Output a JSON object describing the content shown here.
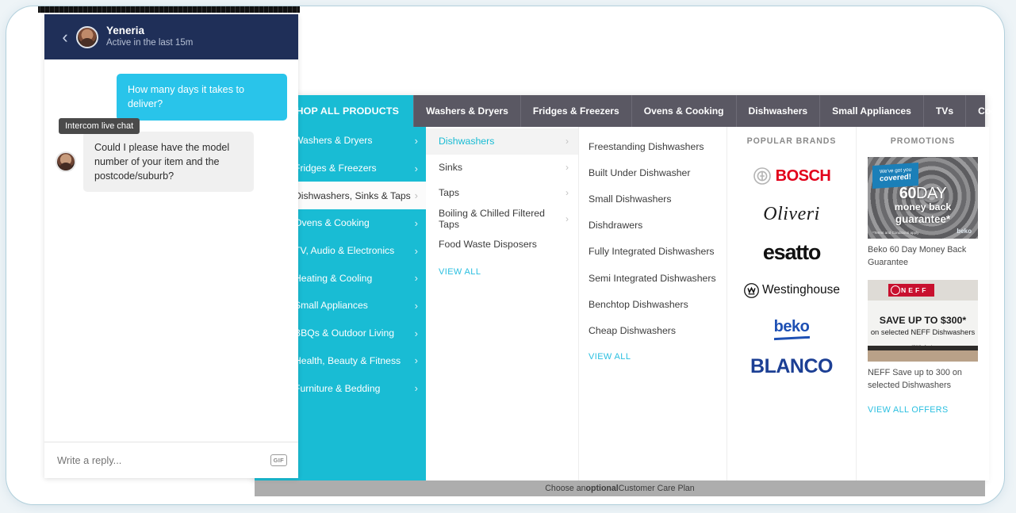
{
  "chat": {
    "back_icon": "chevron-left-icon",
    "name": "Yeneria",
    "status": "Active in the last 15m",
    "tooltip": "Intercom live chat",
    "messages": [
      {
        "from": "user",
        "text": "How many days it takes to deliver?"
      },
      {
        "from": "agent",
        "text": "Could I please have the model number of your item and the postcode/suburb?"
      }
    ],
    "reply_placeholder": "Write a reply...",
    "gif_label": "GIF"
  },
  "shop": {
    "shop_all_label": "SHOP ALL PRODUCTS",
    "menu_icon": "hamburger-icon",
    "nav_items": [
      "Washers & Dryers",
      "Fridges & Freezers",
      "Ovens & Cooking",
      "Dishwashers",
      "Small Appliances",
      "TVs",
      "Cooling"
    ],
    "categories": [
      {
        "label": "Washers & Dryers",
        "icon": "washer-icon",
        "active": false
      },
      {
        "label": "Fridges & Freezers",
        "icon": "fridge-icon",
        "active": false
      },
      {
        "label": "Dishwashers, Sinks & Taps",
        "icon": "dishwasher-icon",
        "active": true
      },
      {
        "label": "Ovens & Cooking",
        "icon": "cooktop-icon",
        "active": false
      },
      {
        "label": "TV, Audio & Electronics",
        "icon": "tv-icon",
        "active": false
      },
      {
        "label": "Heating & Cooling",
        "icon": "aircon-icon",
        "active": false
      },
      {
        "label": "Small Appliances",
        "icon": "blender-icon",
        "active": false
      },
      {
        "label": "BBQs & Outdoor Living",
        "icon": "bbq-icon",
        "active": false
      },
      {
        "label": "Health, Beauty & Fitness",
        "icon": "scales-icon",
        "active": false
      },
      {
        "label": "Furniture & Bedding",
        "icon": "sofa-icon",
        "active": false
      }
    ],
    "subcategories": [
      {
        "label": "Dishwashers",
        "active": true,
        "arrow": true
      },
      {
        "label": "Sinks",
        "active": false,
        "arrow": true
      },
      {
        "label": "Taps",
        "active": false,
        "arrow": true
      },
      {
        "label": "Boiling & Chilled Filtered Taps",
        "active": false,
        "arrow": true
      },
      {
        "label": "Food Waste Disposers",
        "active": false,
        "arrow": false
      }
    ],
    "subcategories_view_all": "VIEW ALL",
    "items": [
      "Freestanding Dishwashers",
      "Built Under Dishwasher",
      "Small Dishwashers",
      "Dishdrawers",
      "Fully Integrated Dishwashers",
      "Semi Integrated Dishwashers",
      "Benchtop Dishwashers",
      "Cheap Dishwashers"
    ],
    "items_view_all": "VIEW ALL",
    "brands_heading": "POPULAR BRANDS",
    "brands": [
      {
        "name": "BOSCH",
        "color": "#e2001a"
      },
      {
        "name": "Oliveri",
        "color": "#1a1a1a"
      },
      {
        "name": "esatto",
        "color": "#111111"
      },
      {
        "name": "Westinghouse",
        "color": "#111111"
      },
      {
        "name": "beko",
        "color": "#1e50b4"
      },
      {
        "name": "BLANCO",
        "color": "#1c3f94"
      }
    ],
    "promotions_heading": "PROMOTIONS",
    "promotions": [
      {
        "caption": "Beko 60 Day Money Back Guarantee",
        "art": {
          "tag_line1": "We've got you",
          "tag_line2": "covered!",
          "big_number": "60",
          "big_word": "DAY",
          "line2": "money back",
          "line3": "guarantee*",
          "fine_print": "*Terms and Conditions apply",
          "brand": "beko"
        }
      },
      {
        "caption": "NEFF Save up to 300 on selected Dishwashers",
        "art": {
          "brand": "NEFF",
          "line1": "SAVE UP TO $300*",
          "line2": "on selected NEFF Dishwashers",
          "fine_print": "*T&Cs Apply"
        }
      }
    ],
    "promotions_view_all": "VIEW ALL OFFERS",
    "footer_prefix": "Choose an ",
    "footer_bold": "optional",
    "footer_suffix": " Customer Care Plan"
  }
}
